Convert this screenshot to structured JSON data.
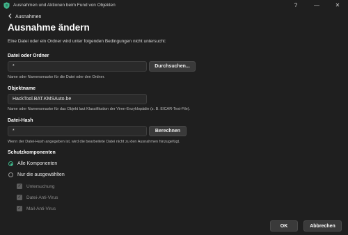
{
  "window": {
    "title": "Ausnahmen und Aktionen beim Fund von Objekten",
    "app_icon": "kaspersky-shield-icon",
    "controls": [
      "?",
      "—",
      "✕"
    ]
  },
  "nav": {
    "back_label": "Ausnahmen",
    "back_icon": "chevron-left-icon"
  },
  "page": {
    "title": "Ausnahme ändern",
    "intro": "Eine Datei oder ein Ordner wird unter folgenden Bedingungen nicht untersucht:"
  },
  "file_or_folder": {
    "label": "Datei oder Ordner",
    "value": "*",
    "button": "Durchsuchen...",
    "hint": "Name oder Namensmaske für die Datei oder den Ordner."
  },
  "object_name": {
    "label": "Objektname",
    "value": "HackTool.BAT.KMSAuto.be",
    "hint": "Name oder Namensmaske für das Objekt laut Klassifikation der Viren-Enzyklopädie (z. B. EICAR-Test-File)."
  },
  "file_hash": {
    "label": "Datei-Hash",
    "value": "*",
    "button": "Berechnen",
    "hint": "Wenn der Datei-Hash angegeben ist, wird die bearbeitete Datei nicht zu den Ausnahmen hinzugefügt."
  },
  "components": {
    "title": "Schutzkomponenten",
    "radio_all": "Alle Komponenten",
    "radio_selected": "Nur die ausgewählten",
    "selected_radio": "all",
    "items": [
      {
        "label": "Untersuchung",
        "checked": true
      },
      {
        "label": "Datei-Anti-Virus",
        "checked": true
      },
      {
        "label": "Mail-Anti-Virus",
        "checked": true
      }
    ]
  },
  "footer": {
    "ok": "OK",
    "cancel": "Abbrechen"
  },
  "colors": {
    "accent": "#3fb58a",
    "background": "#1f1f1f",
    "input_bg": "#2a2a2a",
    "button_bg": "#3a3a3a"
  }
}
